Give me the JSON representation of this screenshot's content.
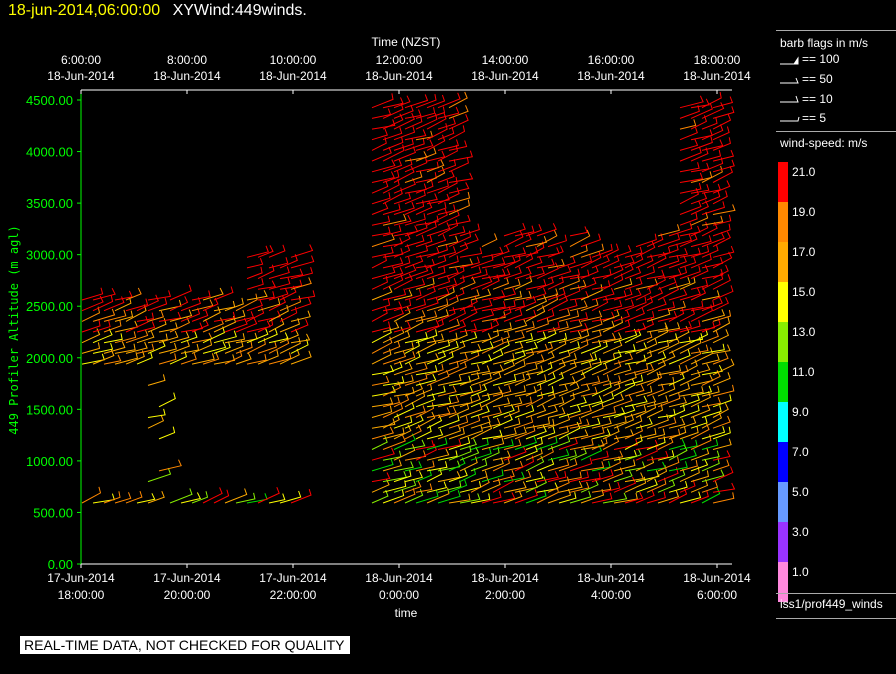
{
  "header": {
    "datetime": "18-jun-2014,06:00:00",
    "title": "XYWind:449winds."
  },
  "legend": {
    "barb_title": "barb flags in m/s",
    "barbs": [
      "== 100",
      "== 50",
      "== 10",
      "== 5"
    ],
    "speed_title": "wind-speed: m/s",
    "source": "iss1/prof449_winds"
  },
  "footer": {
    "notice": "REAL-TIME DATA, NOT CHECKED FOR QUALITY"
  },
  "colors": {
    "axis_green": "#00ff00",
    "header_yellow": "#ffff00"
  },
  "chart_data": {
    "type": "scatter",
    "top_axis_title": "Time (NZST)",
    "bottom_axis_title": "time",
    "ylabel": "449 Profiler Altitude (m agl)",
    "ylim": [
      0,
      4600
    ],
    "yticks": [
      "0.00",
      "500.00",
      "1000.00",
      "1500.00",
      "2000.00",
      "2500.00",
      "3000.00",
      "3500.00",
      "4000.00",
      "4500.00"
    ],
    "top_ticks": [
      [
        "6:00:00",
        "18-Jun-2014"
      ],
      [
        "8:00:00",
        "18-Jun-2014"
      ],
      [
        "10:00:00",
        "18-Jun-2014"
      ],
      [
        "12:00:00",
        "18-Jun-2014"
      ],
      [
        "14:00:00",
        "18-Jun-2014"
      ],
      [
        "16:00:00",
        "18-Jun-2014"
      ],
      [
        "18:00:00",
        "18-Jun-2014"
      ]
    ],
    "bottom_ticks": [
      [
        "17-Jun-2014",
        "18:00:00"
      ],
      [
        "17-Jun-2014",
        "20:00:00"
      ],
      [
        "17-Jun-2014",
        "22:00:00"
      ],
      [
        "18-Jun-2014",
        "0:00:00"
      ],
      [
        "18-Jun-2014",
        "2:00:00"
      ],
      [
        "18-Jun-2014",
        "4:00:00"
      ],
      [
        "18-Jun-2014",
        "6:00:00"
      ]
    ],
    "colorbar": {
      "labels": [
        "21.0",
        "19.0",
        "17.0",
        "15.0",
        "13.0",
        "11.0",
        "9.0",
        "7.0",
        "5.0",
        "3.0",
        "1.0"
      ],
      "colors": [
        "#ff0000",
        "#ff8800",
        "#ffaa00",
        "#ffff00",
        "#88ee00",
        "#00dd00",
        "#00ffff",
        "#0000ff",
        "#6699ff",
        "#9933ff",
        "#ff88dd"
      ]
    }
  }
}
